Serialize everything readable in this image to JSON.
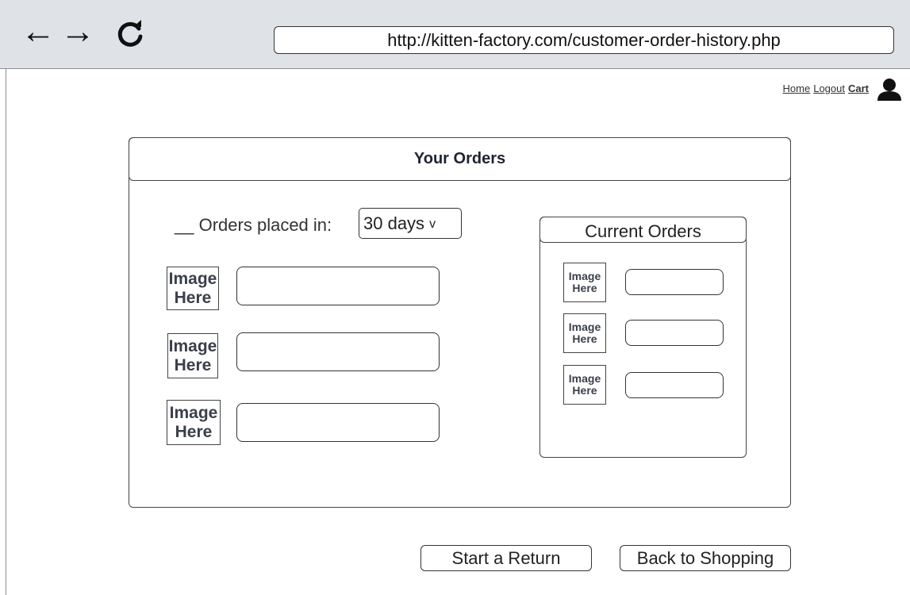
{
  "browser": {
    "back_icon": "←",
    "forward_icon": "→",
    "reload_icon": "⟳",
    "url": "http://kitten-factory.com/customer-order-history.php"
  },
  "top_links": {
    "home": "Home",
    "logout": "Logout",
    "cart": "Cart"
  },
  "panel": {
    "title": "Your Orders",
    "orders_prefix": "__",
    "orders_placed_label": "Orders placed in:",
    "days_select": {
      "value": "30 days",
      "chevron": "v"
    },
    "image_line1": "Image",
    "image_line2": "Here"
  },
  "current_orders": {
    "title": "Current Orders",
    "image_line1": "Image",
    "image_line2": "Here"
  },
  "buttons": {
    "start_return": "Start a Return",
    "back_to_shopping": "Back to Shopping"
  }
}
